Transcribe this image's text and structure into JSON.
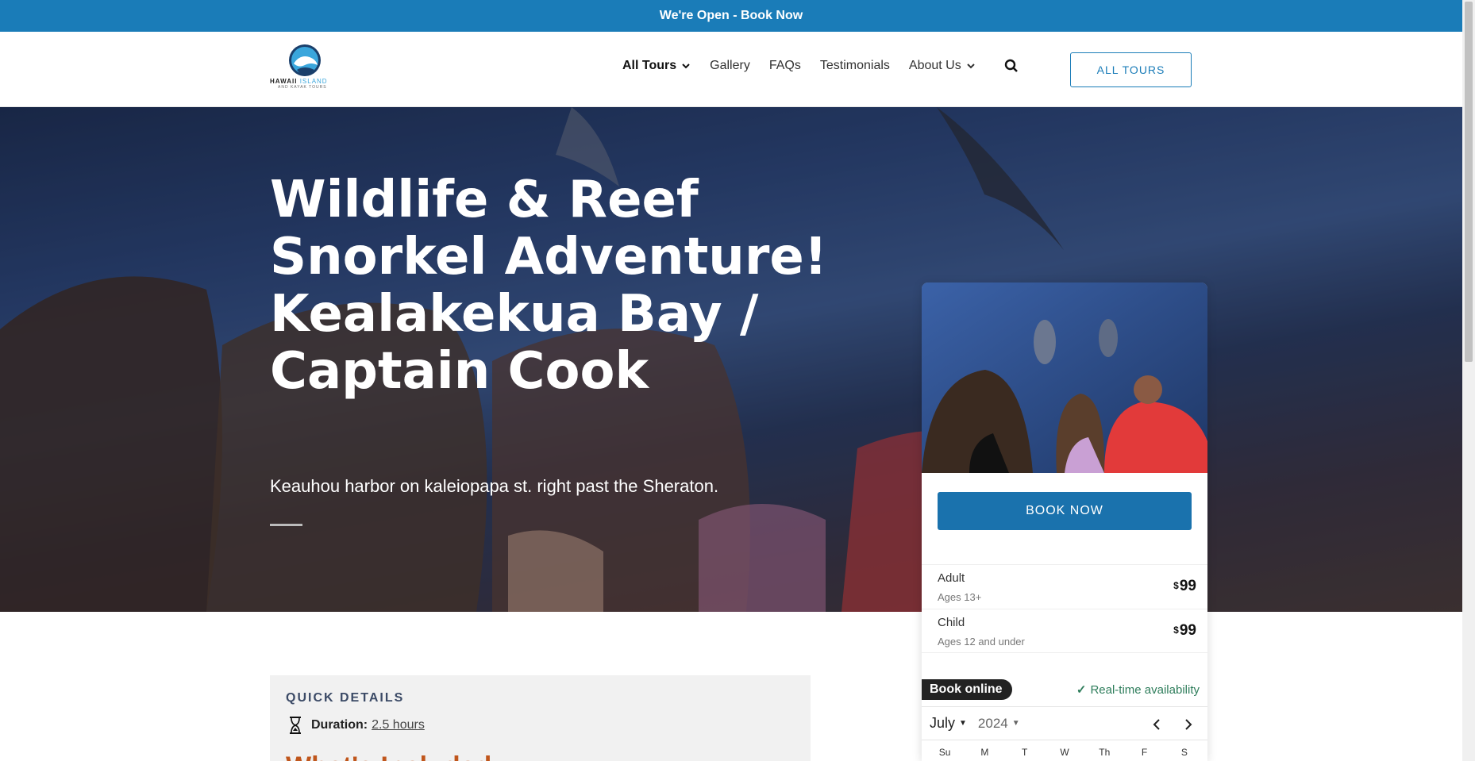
{
  "announcement": "We're Open - Book Now",
  "logo": {
    "name": "HAWAII",
    "name_accent": "ISLAND",
    "tagline": "AND KAYAK TOURS"
  },
  "nav": {
    "items": [
      {
        "label": "All Tours",
        "dropdown": true
      },
      {
        "label": "Gallery"
      },
      {
        "label": "FAQs"
      },
      {
        "label": "Testimonials"
      },
      {
        "label": "About Us",
        "dropdown": true
      }
    ],
    "icon": "search-icon",
    "cta": "ALL TOURS"
  },
  "hero": {
    "title": "Wildlife & Reef Snorkel Adventure! Kealakekua Bay / Captain Cook",
    "subtitle": "Keauhou harbor on kaleiopapa st. right past the Sheraton."
  },
  "quick_details": {
    "heading": "QUICK DETAILS",
    "duration_label": "Duration:",
    "duration_value": "2.5 hours",
    "next_heading": "What's Included"
  },
  "booking": {
    "button": "BOOK NOW",
    "prices": [
      {
        "name": "Adult",
        "ages": "Ages 13+",
        "currency": "$",
        "amount": "99"
      },
      {
        "name": "Child",
        "ages": "Ages 12 and under",
        "currency": "$",
        "amount": "99"
      }
    ],
    "book_online": "Book online",
    "realtime": "Real-time availability",
    "month": "July",
    "year": "2024",
    "weekdays": [
      "Su",
      "M",
      "T",
      "W",
      "Th",
      "F",
      "S"
    ]
  },
  "colors": {
    "brand_blue": "#1a7cb8",
    "accent_orange": "#c0561c",
    "success_green": "#2e7d5b"
  }
}
